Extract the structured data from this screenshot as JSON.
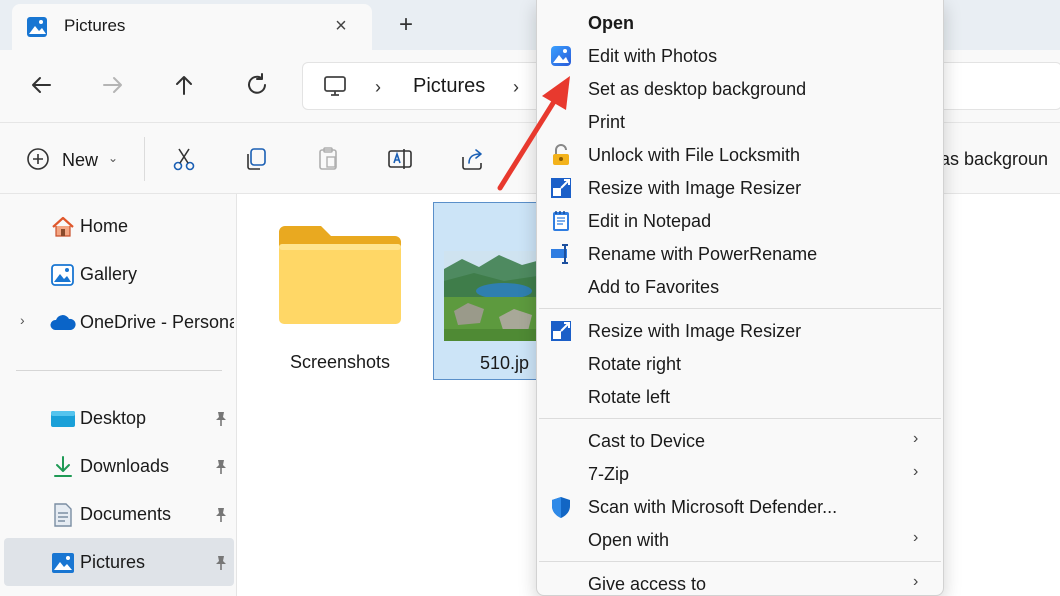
{
  "tab": {
    "title": "Pictures",
    "close_icon": "×",
    "new_tab_icon": "+"
  },
  "address": {
    "crumb": "Pictures",
    "chevron": "›"
  },
  "toolbar": {
    "new_label": "New",
    "new_chevron": "⌄",
    "set_background_partial": "t as backgroun"
  },
  "sidebar": {
    "items": [
      {
        "label": "Home",
        "icon": "home-icon"
      },
      {
        "label": "Gallery",
        "icon": "gallery-icon"
      },
      {
        "label": "OneDrive - Persona",
        "icon": "onedrive-icon",
        "expand": "›"
      },
      {
        "label": "Desktop",
        "icon": "desktop-icon",
        "pinned": true
      },
      {
        "label": "Downloads",
        "icon": "downloads-icon",
        "pinned": true
      },
      {
        "label": "Documents",
        "icon": "documents-icon",
        "pinned": true
      },
      {
        "label": "Pictures",
        "icon": "pictures-icon",
        "pinned": true,
        "selected": true
      }
    ]
  },
  "content": {
    "folder_label": "Screenshots",
    "file_label": "510.jp"
  },
  "context_menu": {
    "items": [
      {
        "label": "Open",
        "bold": true
      },
      {
        "label": "Edit with Photos",
        "icon": "photos-icon"
      },
      {
        "label": "Set as desktop background"
      },
      {
        "label": "Print"
      },
      {
        "label": "Unlock with File Locksmith",
        "icon": "lock-icon"
      },
      {
        "label": "Resize with Image Resizer",
        "icon": "image-resizer-icon"
      },
      {
        "label": "Edit in Notepad",
        "icon": "notepad-icon"
      },
      {
        "label": "Rename with PowerRename",
        "icon": "powerrename-icon"
      },
      {
        "label": "Add to Favorites"
      },
      {
        "label": "Resize with Image Resizer",
        "icon": "image-resizer-icon"
      },
      {
        "label": "Rotate right"
      },
      {
        "label": "Rotate left"
      },
      {
        "label": "Cast to Device",
        "submenu": true
      },
      {
        "label": "7-Zip",
        "submenu": true
      },
      {
        "label": "Scan with Microsoft Defender...",
        "icon": "defender-icon"
      },
      {
        "label": "Open with",
        "submenu": true
      },
      {
        "label": "Give access to",
        "submenu": true
      }
    ],
    "submenu_chevron": "›"
  },
  "colors": {
    "accent": "#0067c0",
    "selection_bg": "#cce4f7",
    "arrow": "#e8392e",
    "folder": "#f8c93e"
  }
}
